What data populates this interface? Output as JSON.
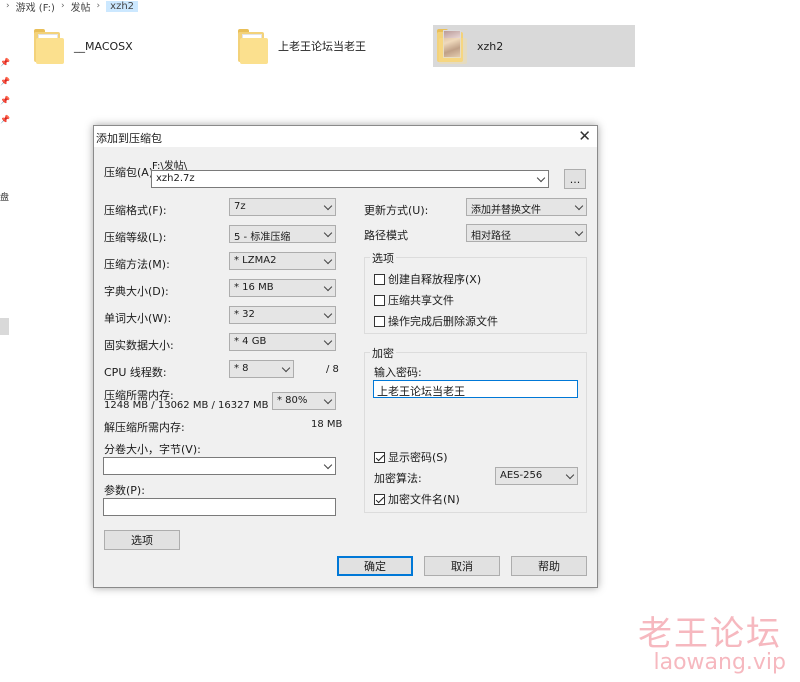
{
  "explorer": {
    "breadcrumb": [
      "游戏 (F:)",
      "发帖",
      "xzh2"
    ],
    "files": [
      {
        "name": "__MACOSX"
      },
      {
        "name": "上老王论坛当老王"
      },
      {
        "name": "xzh2"
      }
    ],
    "side_char": "盘"
  },
  "dialog": {
    "title": "添加到压缩包",
    "close": "✕",
    "archive_label": "压缩包(A):",
    "archive_path": "F:\\发帖\\",
    "archive_name": "xzh2.7z",
    "browse_label": "...",
    "left": {
      "format_label": "压缩格式(F):",
      "format_value": "7z",
      "level_label": "压缩等级(L):",
      "level_value": "5 - 标准压缩",
      "method_label": "压缩方法(M):",
      "method_value": "* LZMA2",
      "dict_label": "字典大小(D):",
      "dict_value": "* 16 MB",
      "word_label": "单词大小(W):",
      "word_value": "* 32",
      "solid_label": "固实数据大小:",
      "solid_value": "* 4 GB",
      "threads_label": "CPU 线程数:",
      "threads_value": "* 8",
      "threads_total": "/ 8",
      "mem_compress_label": "压缩所需内存:",
      "mem_compress_value": "1248 MB / 13062 MB / 16327 MB",
      "mem_percent": "* 80%",
      "mem_decompress_label": "解压缩所需内存:",
      "mem_decompress_value": "18 MB",
      "volume_label": "分卷大小，字节(V):",
      "volume_value": "",
      "params_label": "参数(P):",
      "params_value": "",
      "options_button": "选项"
    },
    "right": {
      "update_label": "更新方式(U):",
      "update_value": "添加并替换文件",
      "path_label": "路径模式",
      "path_value": "相对路径",
      "options_group": "选项",
      "opt_sfx": "创建自释放程序(X)",
      "opt_shared": "压缩共享文件",
      "opt_delete": "操作完成后删除源文件",
      "encrypt_group": "加密",
      "password_label": "输入密码:",
      "password_value": "上老王论坛当老王",
      "show_password": "显示密码(S)",
      "method_label": "加密算法:",
      "method_value": "AES-256",
      "encrypt_names": "加密文件名(N)"
    },
    "buttons": {
      "ok": "确定",
      "cancel": "取消",
      "help": "帮助"
    }
  },
  "watermark": {
    "line1": "老王论坛",
    "line2": "laowang.vip"
  }
}
